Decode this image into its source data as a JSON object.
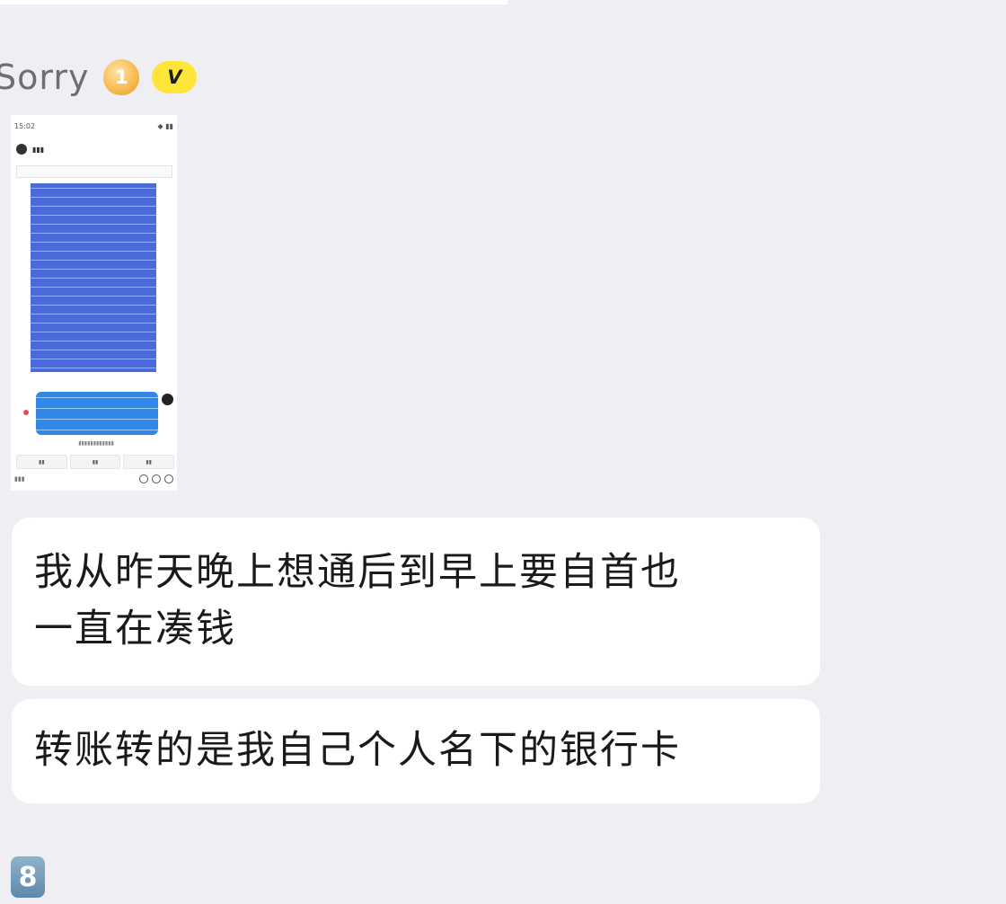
{
  "sender": {
    "name": "Sorry",
    "level_badge": "1",
    "verified_badge": "V"
  },
  "thumbnail": {
    "status_time": "15:02",
    "status_icons": "◆ ▮▮",
    "header_name": "▮▮▮",
    "caption": "▮▮▮▮▮▮▮▮▮▮▮▮",
    "actions": [
      "▮▮",
      "▮▮",
      "▮▮"
    ],
    "input_hint": "▮▮▮"
  },
  "messages": [
    {
      "line1": "我从昨天晚上想通后到早上要自首也",
      "line2": "一直在凑钱"
    },
    {
      "line1": "转账转的是我自己个人名下的银行卡"
    }
  ],
  "corner_badge": "8",
  "colors": {
    "background": "#efeff3",
    "bubble": "#ffffff",
    "text": "#1a1a1a",
    "sender_name": "#6e6e73",
    "level_badge": "#f6b94c",
    "verified_badge": "#ffe53a"
  },
  "icons": [
    "level-medal-icon",
    "verified-v-icon",
    "corner-app-icon"
  ]
}
